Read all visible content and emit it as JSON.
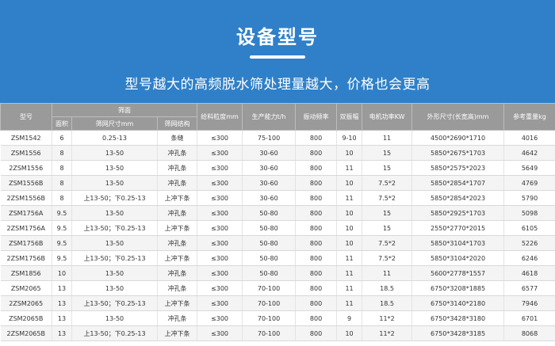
{
  "banner": {
    "title": "设备型号",
    "subtitle": "型号越大的高频脱水筛处理量越大，价格也会更高"
  },
  "table": {
    "header": {
      "model": "型号",
      "screen_group": "筛面",
      "area": "面积",
      "mesh_size": "筛网尺寸mm",
      "mesh_structure": "筛网结构",
      "feed_size": "给料粒度mm",
      "capacity": "生产能力t/h",
      "vib_freq": "振动频率",
      "amplitude": "双振幅",
      "motor_power": "电机功率KW",
      "dimensions": "外形尺寸(长宽高)mm",
      "weight": "参考重量kg"
    },
    "rows": [
      [
        "ZSM1542",
        "6",
        "0.25-13",
        "条缝",
        "≤300",
        "75-100",
        "800",
        "9-10",
        "11",
        "4500*2690*1710",
        "4016"
      ],
      [
        "ZSM1556",
        "8",
        "13-50",
        "冲孔条",
        "≤300",
        "30-60",
        "800",
        "10",
        "15",
        "5850*2675*1703",
        "4642"
      ],
      [
        "2ZSM1556",
        "8",
        "13-50",
        "冲孔条",
        "≤300",
        "30-60",
        "800",
        "11",
        "15",
        "5850*2575*2023",
        "5649"
      ],
      [
        "ZSM1556B",
        "8",
        "13-50",
        "冲孔条",
        "≤300",
        "30-60",
        "800",
        "10",
        "7.5*2",
        "5850*2854*1707",
        "4769"
      ],
      [
        "2ZSM1556B",
        "8",
        "上13-50；下0.25-13",
        "上冲下条",
        "≤300",
        "30-60",
        "800",
        "11",
        "7.5*2",
        "5850*2854*2023",
        "5790"
      ],
      [
        "ZSM1756A",
        "9.5",
        "13-50",
        "冲孔条",
        "≤300",
        "50-80",
        "800",
        "10",
        "15",
        "5850*2925*1703",
        "5098"
      ],
      [
        "2ZSM1756A",
        "9.5",
        "上13-50；下0.25-13",
        "上冲下条",
        "≤300",
        "50-80",
        "800",
        "10",
        "15",
        "2550*2770*2015",
        "6105"
      ],
      [
        "ZSM1756B",
        "9.5",
        "13-50",
        "冲孔条",
        "≤300",
        "50-80",
        "800",
        "10",
        "7.5*2",
        "5850*3104*1703",
        "5226"
      ],
      [
        "2ZSM1756B",
        "9.5",
        "上13-50；下0.25-13",
        "上冲下条",
        "≤300",
        "50-80",
        "800",
        "11",
        "7.5*2",
        "5850*3104*2020",
        "6246"
      ],
      [
        "ZSM1856",
        "10",
        "13-50",
        "冲孔条",
        "≤300",
        "50-80",
        "800",
        "11",
        "11",
        "5600*2778*1557",
        "4618"
      ],
      [
        "ZSM2065",
        "13",
        "13-50",
        "冲孔条",
        "≤300",
        "70-100",
        "800",
        "11",
        "18.5",
        "6750*3208*1885",
        "6577"
      ],
      [
        "2ZSM2065",
        "13",
        "上13-50；下0.25-13",
        "上冲下条",
        "≤300",
        "70-100",
        "800",
        "11",
        "18.5",
        "6750*3140*2180",
        "7946"
      ],
      [
        "ZSM2065B",
        "13",
        "13-50",
        "冲孔条",
        "≤300",
        "70-100",
        "800",
        "9",
        "11*2",
        "6750*3428*3180",
        "6701"
      ],
      [
        "2ZSM2065B",
        "13",
        "上13-50；下0.25-13",
        "上冲下条",
        "≤300",
        "70-100",
        "800",
        "10",
        "11*2",
        "6750*3428*3185",
        "8068"
      ]
    ]
  },
  "colors": {
    "banner_bg": "#2f80c8",
    "header_bg": "#9a9a9a",
    "row_alt_bg": "#f4f4f4"
  }
}
